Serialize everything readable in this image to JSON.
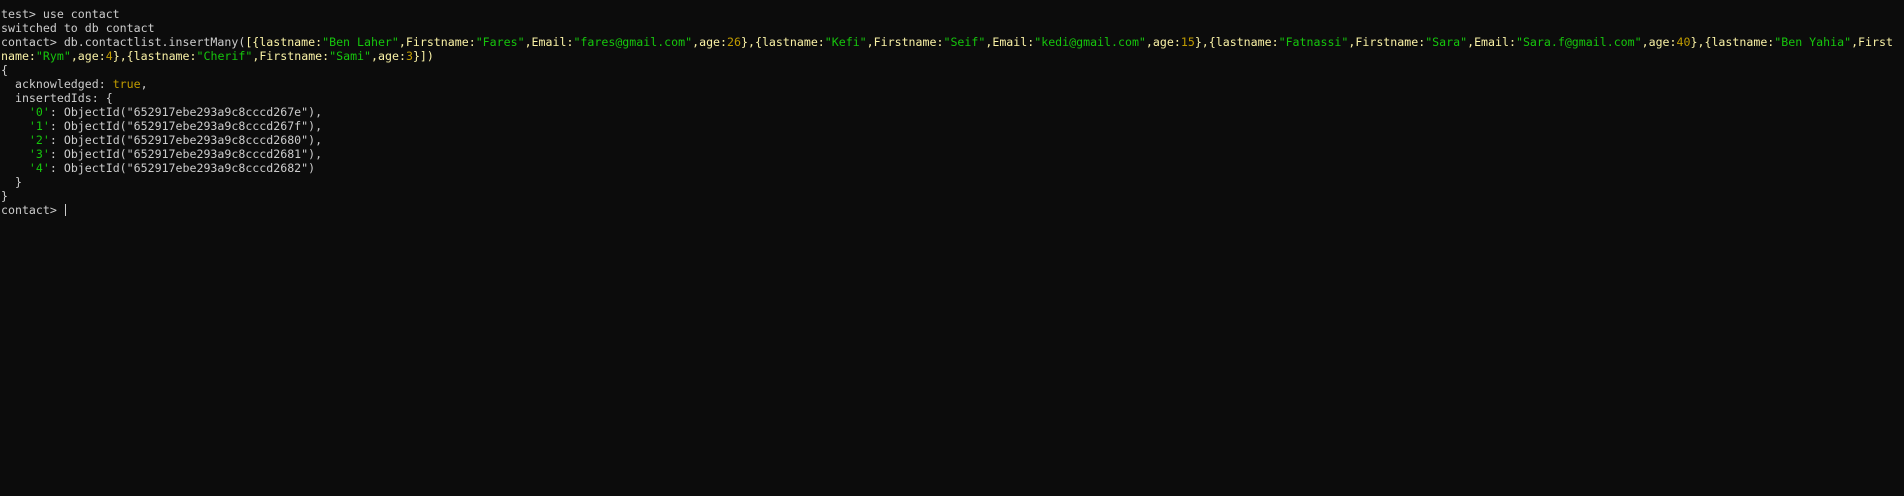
{
  "terminal": {
    "line1": "test> use contact",
    "line2": "switched to db contact",
    "cmd_prompt": "contact> ",
    "cmd_code": "db.contactlist.insertMany(",
    "cmd_open": "[",
    "tokens_line3": [
      {
        "t": "[{",
        "c": "punct"
      },
      {
        "t": "lastname",
        "c": "key"
      },
      {
        "t": ":",
        "c": "punct"
      },
      {
        "t": "\"Ben Laher\"",
        "c": "str"
      },
      {
        "t": ",",
        "c": "punct"
      },
      {
        "t": "Firstname",
        "c": "key"
      },
      {
        "t": ":",
        "c": "punct"
      },
      {
        "t": "\"Fares\"",
        "c": "str"
      },
      {
        "t": ",",
        "c": "punct"
      },
      {
        "t": "Email",
        "c": "key"
      },
      {
        "t": ":",
        "c": "punct"
      },
      {
        "t": "\"fares@gmail.com\"",
        "c": "str"
      },
      {
        "t": ",",
        "c": "punct"
      },
      {
        "t": "age",
        "c": "key"
      },
      {
        "t": ":",
        "c": "punct"
      },
      {
        "t": "26",
        "c": "num"
      },
      {
        "t": "},{",
        "c": "punct"
      },
      {
        "t": "lastname",
        "c": "key"
      },
      {
        "t": ":",
        "c": "punct"
      },
      {
        "t": "\"Kefi\"",
        "c": "str"
      },
      {
        "t": ",",
        "c": "punct"
      },
      {
        "t": "Firstname",
        "c": "key"
      },
      {
        "t": ":",
        "c": "punct"
      },
      {
        "t": "\"Seif\"",
        "c": "str"
      },
      {
        "t": ",",
        "c": "punct"
      },
      {
        "t": "Email",
        "c": "key"
      },
      {
        "t": ":",
        "c": "punct"
      },
      {
        "t": "\"kedi@gmail.com\"",
        "c": "str"
      },
      {
        "t": ",",
        "c": "punct"
      },
      {
        "t": "age",
        "c": "key"
      },
      {
        "t": ":",
        "c": "punct"
      },
      {
        "t": "15",
        "c": "num"
      },
      {
        "t": "},{",
        "c": "punct"
      },
      {
        "t": "lastname",
        "c": "key"
      },
      {
        "t": ":",
        "c": "punct"
      },
      {
        "t": "\"Fatnassi\"",
        "c": "str"
      },
      {
        "t": ",",
        "c": "punct"
      },
      {
        "t": "Firstname",
        "c": "key"
      },
      {
        "t": ":",
        "c": "punct"
      },
      {
        "t": "\"Sara\"",
        "c": "str"
      },
      {
        "t": ",",
        "c": "punct"
      },
      {
        "t": "Email",
        "c": "key"
      },
      {
        "t": ":",
        "c": "punct"
      },
      {
        "t": "\"Sara.f@gmail.com\"",
        "c": "str"
      },
      {
        "t": ",",
        "c": "punct"
      },
      {
        "t": "age",
        "c": "key"
      },
      {
        "t": ":",
        "c": "punct"
      },
      {
        "t": "40",
        "c": "num"
      },
      {
        "t": "},{",
        "c": "punct"
      },
      {
        "t": "lastname",
        "c": "key"
      },
      {
        "t": ":",
        "c": "punct"
      },
      {
        "t": "\"Ben Yahia\"",
        "c": "str"
      },
      {
        "t": ",",
        "c": "punct"
      },
      {
        "t": "First",
        "c": "key"
      }
    ],
    "tokens_line4": [
      {
        "t": "name",
        "c": "key"
      },
      {
        "t": ":",
        "c": "punct"
      },
      {
        "t": "\"Rym\"",
        "c": "str"
      },
      {
        "t": ",",
        "c": "punct"
      },
      {
        "t": "age",
        "c": "key"
      },
      {
        "t": ":",
        "c": "punct"
      },
      {
        "t": "4",
        "c": "num"
      },
      {
        "t": "},{",
        "c": "punct"
      },
      {
        "t": "lastname",
        "c": "key"
      },
      {
        "t": ":",
        "c": "punct"
      },
      {
        "t": "\"Cherif\"",
        "c": "str"
      },
      {
        "t": ",",
        "c": "punct"
      },
      {
        "t": "Firstname",
        "c": "key"
      },
      {
        "t": ":",
        "c": "punct"
      },
      {
        "t": "\"Sami\"",
        "c": "str"
      },
      {
        "t": ",",
        "c": "punct"
      },
      {
        "t": "age",
        "c": "key"
      },
      {
        "t": ":",
        "c": "punct"
      },
      {
        "t": "3",
        "c": "num"
      },
      {
        "t": "}])",
        "c": "punct"
      }
    ],
    "brace_open": "{",
    "ack_key": "  acknowledged: ",
    "ack_val": "true",
    "ack_comma": ",",
    "ids_key": "  insertedIds: {",
    "ids": [
      {
        "idx": "'0'",
        "oid": "ObjectId(\"652917ebe293a9c8cccd267e\"),"
      },
      {
        "idx": "'1'",
        "oid": "ObjectId(\"652917ebe293a9c8cccd267f\"),"
      },
      {
        "idx": "'2'",
        "oid": "ObjectId(\"652917ebe293a9c8cccd2680\"),"
      },
      {
        "idx": "'3'",
        "oid": "ObjectId(\"652917ebe293a9c8cccd2681\"),"
      },
      {
        "idx": "'4'",
        "oid": "ObjectId(\"652917ebe293a9c8cccd2682\")"
      }
    ],
    "ids_close": "  }",
    "brace_close": "}",
    "final_prompt": "contact> "
  },
  "colors": {
    "background": "#0c0c0c",
    "text": "#cccccc",
    "string": "#16c60c",
    "number": "#c19c00",
    "key": "#f9f1a5"
  }
}
